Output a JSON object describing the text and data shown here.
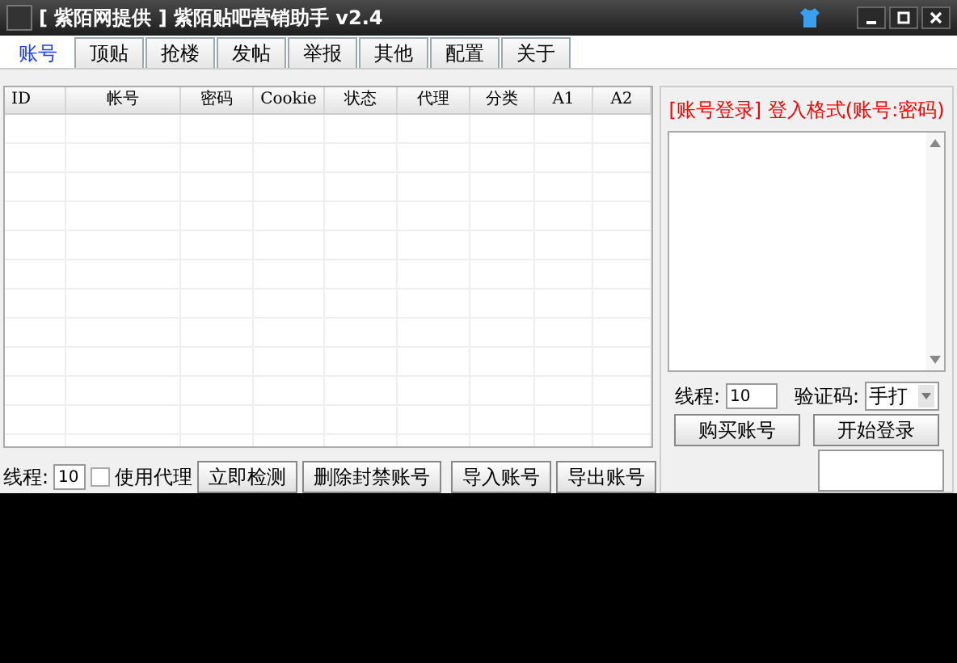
{
  "window": {
    "title": "[ 紫陌网提供 ] 紫陌贴吧营销助手 v2.4"
  },
  "tabs": [
    {
      "label": "账号",
      "selected": true
    },
    {
      "label": "顶贴",
      "selected": false
    },
    {
      "label": "抢楼",
      "selected": false
    },
    {
      "label": "发帖",
      "selected": false
    },
    {
      "label": "举报",
      "selected": false
    },
    {
      "label": "其他",
      "selected": false
    },
    {
      "label": "配置",
      "selected": false
    },
    {
      "label": "关于",
      "selected": false
    }
  ],
  "table": {
    "columns": [
      "ID",
      "帐号",
      "密码",
      "Cookie",
      "状态",
      "代理",
      "分类",
      "A1",
      "A2"
    ]
  },
  "account_toolbar": {
    "threads_label": "线程:",
    "threads_value": "10",
    "use_proxy": {
      "label": "使用代理",
      "checked": false
    },
    "buttons": [
      "立即检测",
      "删除封禁账号",
      "导入账号",
      "导出账号"
    ]
  },
  "login_panel": {
    "heading": "[账号登录] 登入格式(账号:密码)",
    "threads_label": "线程:",
    "threads_value": "10",
    "captcha_label": "验证码:",
    "captcha_value": "手打",
    "buttons": [
      "购买账号",
      "开始登录"
    ]
  }
}
